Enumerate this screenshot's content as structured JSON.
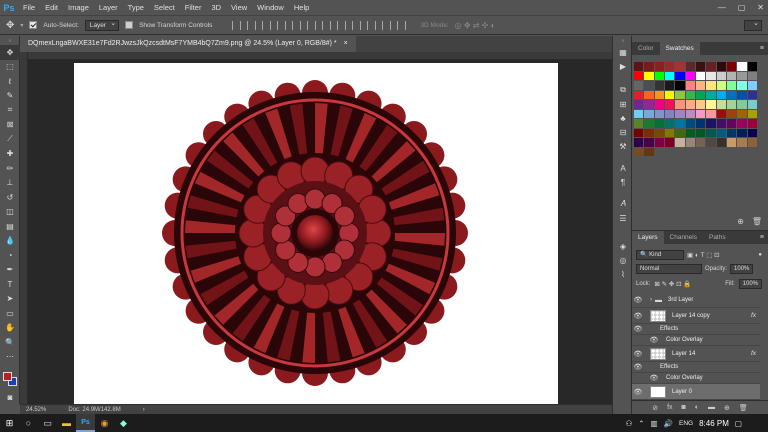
{
  "app": {
    "logo": "Ps",
    "menu": [
      "File",
      "Edit",
      "Image",
      "Layer",
      "Type",
      "Select",
      "Filter",
      "3D",
      "View",
      "Window",
      "Help"
    ],
    "window_controls": [
      "—",
      "▢",
      "✕"
    ]
  },
  "options": {
    "auto_select_label": "Auto-Select:",
    "auto_select_value": "Layer",
    "transform_label": "Show Transform Controls",
    "mode_3d": "3D Mode:"
  },
  "document": {
    "tab_title": "DQmexLngaBWXE31e7Fd2RJwzsJkQzcsdtMsF7YMB4bQ7Zm9.png @ 24.5% (Layer 0, RGB/8#) *",
    "tab_close": "×"
  },
  "status": {
    "zoom": "24.52%",
    "doc_size": "Doc: 24.9M/142.8M",
    "arrow": "›"
  },
  "swatches": {
    "tabs": [
      "Color",
      "Swatches"
    ],
    "active_tab": "Swatches",
    "colors": [
      "#5c1414",
      "#7a1a1a",
      "#8b2020",
      "#9a2a2a",
      "#a83030",
      "#5a2a2a",
      "#3a1010",
      "#6a2020",
      "#2a0a0a",
      "#7a0000",
      "#ffffff",
      "#000000",
      "#ff0000",
      "#ffff00",
      "#00ff00",
      "#00ffff",
      "#0000ff",
      "#ff00ff",
      "#ffffff",
      "#e6e6e6",
      "#cccccc",
      "#b3b3b3",
      "#999999",
      "#808080",
      "#666666",
      "#4d4d4d",
      "#333333",
      "#1a1a1a",
      "#000000",
      "#ff8080",
      "#ffb380",
      "#ffe680",
      "#ccff80",
      "#80ff99",
      "#80ffe6",
      "#80ccff",
      "#ed1c24",
      "#f26522",
      "#f7941d",
      "#fff200",
      "#8dc63f",
      "#39b54a",
      "#00a651",
      "#00a99d",
      "#00aeef",
      "#0072bc",
      "#0054a6",
      "#2e3192",
      "#662d91",
      "#92278f",
      "#ec008c",
      "#ed145b",
      "#f69679",
      "#f9ad81",
      "#fdc68a",
      "#fff799",
      "#c4df9b",
      "#a3d39c",
      "#82ca9c",
      "#7accc8",
      "#6dcff6",
      "#7da7d9",
      "#8393ca",
      "#8781bd",
      "#a186be",
      "#bd8cbf",
      "#f49ac2",
      "#f6989d",
      "#9e0b0f",
      "#a0410d",
      "#a36209",
      "#aba000",
      "#598527",
      "#1a7b30",
      "#007236",
      "#00746b",
      "#0076a3",
      "#004b80",
      "#003471",
      "#1b1464",
      "#440e62",
      "#630460",
      "#9e005d",
      "#9e0039",
      "#790000",
      "#7b2e00",
      "#7d4900",
      "#827b00",
      "#406618",
      "#005e20",
      "#005826",
      "#005952",
      "#005b7f",
      "#003663",
      "#002157",
      "#0d004c",
      "#32004b",
      "#4b0049",
      "#7b0046",
      "#7a0026",
      "#c7b299",
      "#998675",
      "#736357",
      "#534741",
      "#37302d",
      "#c69c6d",
      "#a67c52",
      "#8c6239",
      "#754c24",
      "#603913"
    ]
  },
  "layers": {
    "tabs": [
      "Layers",
      "Channels",
      "Paths"
    ],
    "active_tab": "Layers",
    "kind": "Kind",
    "blend_mode": "Normal",
    "opacity_label": "Opacity:",
    "opacity_value": "100%",
    "lock_label": "Lock:",
    "fill_label": "Fill:",
    "fill_value": "100%",
    "items": [
      {
        "name": "3rd Layer",
        "type": "group"
      },
      {
        "name": "Layer 14 copy",
        "type": "layer",
        "fx": "fx"
      },
      {
        "name": "Effects",
        "type": "effects"
      },
      {
        "name": "Color Overlay",
        "type": "effect"
      },
      {
        "name": "Layer 14",
        "type": "layer",
        "fx": "fx"
      },
      {
        "name": "Effects",
        "type": "effects"
      },
      {
        "name": "Color Overlay",
        "type": "effect"
      },
      {
        "name": "Layer 0",
        "type": "layer",
        "selected": true
      }
    ]
  },
  "taskbar": {
    "search_placeholder": "",
    "tray_lang": "ENG",
    "clock": "8:46 PM"
  },
  "colors": {
    "accent": "#31a8ff",
    "foreground": "#b22222",
    "background": "#1a3fb0",
    "artwork_dark": "#2a0608",
    "artwork_mid": "#8b1a1e",
    "artwork_light": "#c8383c"
  }
}
